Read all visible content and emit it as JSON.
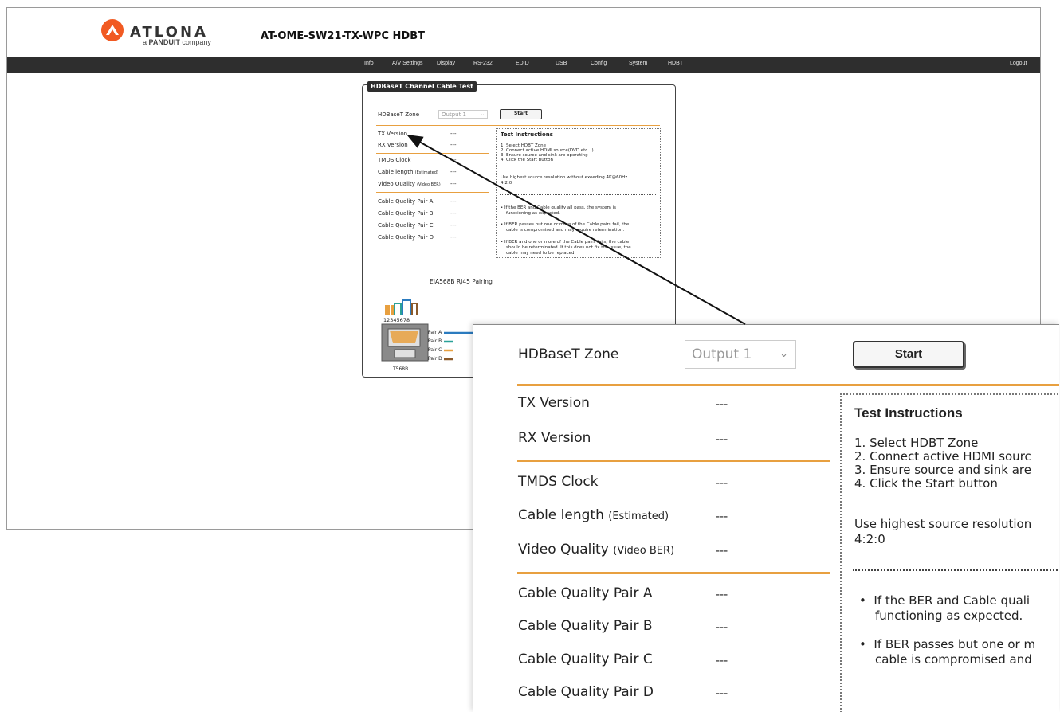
{
  "brand": {
    "logo_text": "ATLONA",
    "logo_sub_prefix": "a",
    "logo_sub_brand": "PANDUIT",
    "logo_sub_suffix": "company",
    "accent_color": "#f15a22"
  },
  "device_title": "AT-OME-SW21-TX-WPC  HDBT",
  "nav": {
    "items": [
      "Info",
      "A/V Settings",
      "Display",
      "RS-232",
      "EDID",
      "USB",
      "Config",
      "System",
      "HDBT"
    ],
    "logout": "Logout"
  },
  "panel": {
    "title": "HDBaseT Channel Cable Test",
    "zone_label": "HDBaseT Zone",
    "zone_value": "Output 1",
    "start_label": "Start",
    "tx_label": "TX Version",
    "tx_value": "---",
    "rx_label": "RX Version",
    "rx_value": "---",
    "tmds_label": "TMDS Clock",
    "tmds_value": "---",
    "cable_length_label": "Cable length",
    "cable_length_note": "(Estimated)",
    "cable_length_value": "---",
    "video_quality_label": "Video Quality",
    "video_quality_note": "(Video BER)",
    "video_quality_value": "---",
    "pair_a_label": "Cable Quality Pair A",
    "pair_a_value": "---",
    "pair_b_label": "Cable Quality Pair B",
    "pair_b_value": "---",
    "pair_c_label": "Cable Quality Pair C",
    "pair_c_value": "---",
    "pair_d_label": "Cable Quality Pair D",
    "pair_d_value": "---",
    "instructions": {
      "title": "Test Instructions",
      "step1": "1. Select HDBT Zone",
      "step2": "2. Connect active HDMI source(DVD etc...)",
      "step3": "3. Ensure source and sink are operating",
      "step4": "4. Click the Start button",
      "resolution_line1": "Use highest source resolution without exeeding 4K@60Hz",
      "resolution_line2": "4:2:0",
      "bullet1_line1": "If the BER and Cable quality all pass, the system is",
      "bullet1_line2": "functioning as expected.",
      "bullet2_line1": "If BER passes but one or more of the Cable pairs fail, the",
      "bullet2_line2": "cable is compromised and may require retermination.",
      "bullet3_line1": "If BER and one or more of the Cable pairs fails, the cable",
      "bullet3_line2": "should be reterminated. If this does not fix the issue, the",
      "bullet3_line3": "cable may need to be replaced."
    },
    "rj45": {
      "title": "EIA568B  RJ45 Pairing",
      "pin_numbers": "12345678",
      "standard": "T568B",
      "pair_a": "Pair A",
      "pair_b": "Pair B",
      "pair_c": "Pair C",
      "pair_d": "Pair D"
    }
  },
  "zoom": {
    "zone_label": "HDBaseT Zone",
    "zone_value": "Output 1",
    "start_label": "Start",
    "tx_label": "TX Version",
    "tx_value": "---",
    "rx_label": "RX Version",
    "rx_value": "---",
    "tmds_label": "TMDS Clock",
    "tmds_value": "---",
    "cable_length_label": "Cable length",
    "cable_length_note": "(Estimated)",
    "cable_length_value": "---",
    "video_quality_label": "Video Quality",
    "video_quality_note": "(Video BER)",
    "video_quality_value": "---",
    "pair_a_label": "Cable Quality Pair A",
    "pair_a_value": "---",
    "pair_b_label": "Cable Quality Pair B",
    "pair_b_value": "---",
    "pair_c_label": "Cable Quality Pair C",
    "pair_c_value": "---",
    "pair_d_label": "Cable Quality Pair D",
    "pair_d_value": "---",
    "instructions": {
      "title": "Test Instructions",
      "step1": "1. Select HDBT Zone",
      "step2": "2. Connect active HDMI sourc",
      "step3": "3. Ensure source and sink are",
      "step4": "4. Click the Start button",
      "resolution_line1": "Use highest source resolution",
      "resolution_line2": "4:2:0",
      "bullet1_line1": "If the BER and Cable quali",
      "bullet1_line2": "functioning as expected.",
      "bullet2_line1": "If BER passes but one or m",
      "bullet2_line2": "cable is compromised and"
    }
  },
  "colors": {
    "navbar": "#2e2e2e",
    "divider": "#e8a040",
    "pair_a": "#2b7bbf",
    "pair_b": "#2aa198",
    "pair_c": "#e8a040",
    "pair_d": "#8b5a2b"
  }
}
